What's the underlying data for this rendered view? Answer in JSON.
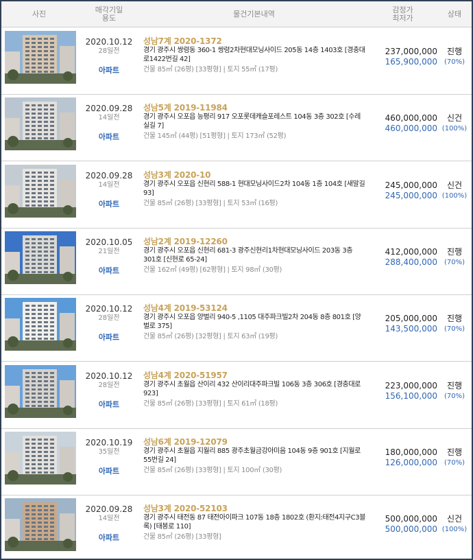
{
  "header": {
    "photo": "사진",
    "date_line1": "매각기일",
    "date_line2": "용도",
    "details": "물건기본내역",
    "price_line1": "감정가",
    "price_line2": "최저가",
    "status": "상태"
  },
  "items": [
    {
      "date": "2020.10.12",
      "days": "28일전",
      "use": "아파트",
      "case": "성남7계 2020-1372",
      "address": "경기 광주시 쌍령동 360-1 쌍령2차현대모닝사이드 205동 14층 1403호 [경충대로1422번길 42]",
      "size": "건물 85㎡ (26평) [33평형]  |  토지 55㎡ (17평)",
      "appraisal": "237,000,000",
      "minimum": "165,900,000",
      "status": "진행",
      "ratio": "(70%)"
    },
    {
      "date": "2020.09.28",
      "days": "14일전",
      "use": "아파트",
      "case": "성남5계 2019-11984",
      "address": "경기 광주시 오포읍 능평리 917 오포롯데캐슬포레스트 104동 3층 302호 [수레실길 7]",
      "size": "건물 145㎡ (44평) [51평형]  |  토지 173㎡ (52평)",
      "appraisal": "460,000,000",
      "minimum": "460,000,000",
      "status": "신건",
      "ratio": "(100%)"
    },
    {
      "date": "2020.09.28",
      "days": "14일전",
      "use": "아파트",
      "case": "성남3계 2020-10",
      "address": "경기 광주시 오포읍 신현리 588-1 현대모닝사이드2차 104동 1층 104호 [새말길 93]",
      "size": "건물 85㎡ (26평) [33평형]  |  토지 53㎡ (16평)",
      "appraisal": "245,000,000",
      "minimum": "245,000,000",
      "status": "신건",
      "ratio": "(100%)"
    },
    {
      "date": "2020.10.05",
      "days": "21일전",
      "use": "아파트",
      "case": "성남2계 2019-12260",
      "address": "경기 광주시 오포읍 신현리 681-3 광주신현리1차현대모닝사이드 203동 3층 301호 [신현로 65-24]",
      "size": "건물 162㎡ (49평) [62평형]  |  토지 98㎡ (30평)",
      "appraisal": "412,000,000",
      "minimum": "288,400,000",
      "status": "진행",
      "ratio": "(70%)"
    },
    {
      "date": "2020.10.12",
      "days": "28일전",
      "use": "아파트",
      "case": "성남4계 2019-53124",
      "address": "경기 광주시 오포읍 양벌리 940-5 ,1105 대주파크빌2차 204동 8층 801호 [양벌로 375]",
      "size": "건물 85㎡ (26평) [32평형]  |  토지 63㎡ (19평)",
      "appraisal": "205,000,000",
      "minimum": "143,500,000",
      "status": "진행",
      "ratio": "(70%)"
    },
    {
      "date": "2020.10.12",
      "days": "28일전",
      "use": "아파트",
      "case": "성남4계 2020-51957",
      "address": "경기 광주시 초월읍 산이리 432 산이리대주파크빌 106동 3층 306호 [경충대로 923]",
      "size": "건물 85㎡ (26평) [33평형]  |  토지 61㎡ (18평)",
      "appraisal": "223,000,000",
      "minimum": "156,100,000",
      "status": "진행",
      "ratio": "(70%)"
    },
    {
      "date": "2020.10.19",
      "days": "35일전",
      "use": "아파트",
      "case": "성남6계 2019-12079",
      "address": "경기 광주시 초월읍 지월리 885 광주초월금강아미음 104동 9층 901호 [지월로55번길 24]",
      "size": "건물 85㎡ (26평) [33평형]  |  토지 100㎡ (30평)",
      "appraisal": "180,000,000",
      "minimum": "126,000,000",
      "status": "진행",
      "ratio": "(70%)"
    },
    {
      "date": "2020.09.28",
      "days": "14일전",
      "use": "아파트",
      "case": "성남3계 2020-52103",
      "address": "경기 광주시 태전동 87 태전아이파크 107동 18층 1802호 (환지:태전4지구C3블록) [태봉로 110]",
      "size": "건물 85㎡ (26평) [33평형]",
      "appraisal": "500,000,000",
      "minimum": "500,000,000",
      "status": "신건",
      "ratio": "(100%)"
    }
  ]
}
